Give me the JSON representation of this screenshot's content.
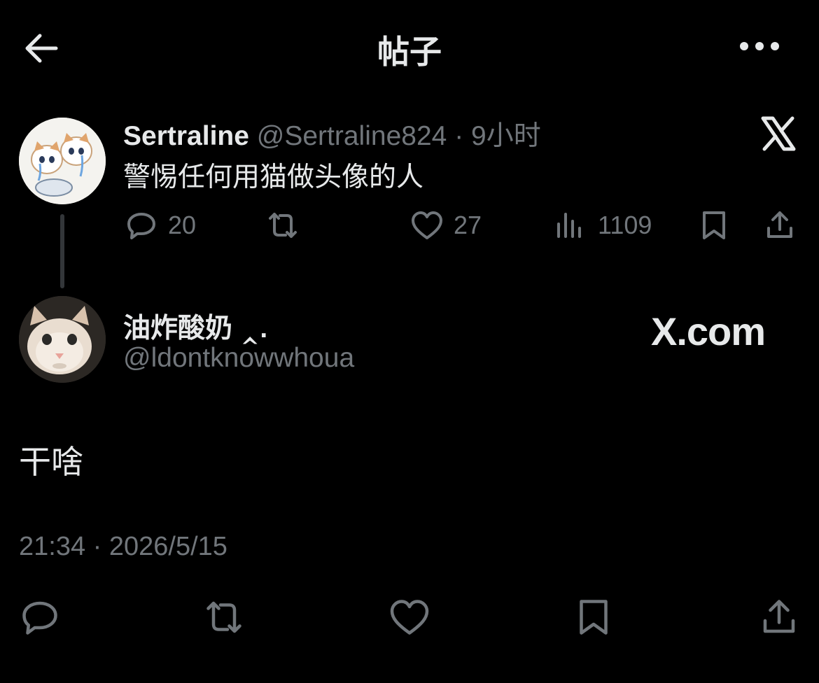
{
  "header": {
    "title": "帖子",
    "back_icon": "back-arrow-icon",
    "more_icon": "more-horizontal-icon"
  },
  "quoted_post": {
    "display_name": "Sertraline",
    "handle": "@Sertraline824",
    "separator": "·",
    "time": "9小时",
    "text": "警惕任何用猫做头像的人",
    "stats": {
      "replies": "20",
      "likes": "27",
      "views": "1109"
    }
  },
  "post": {
    "author_name": "油炸酸奶 ‸.",
    "author_handle": "@ldontknowwhoua",
    "watermark": "X.com",
    "text": "干啥",
    "timestamp": "21:34 · 2026/5/15"
  },
  "colors": {
    "background": "#000000",
    "text": "#e7e9ea",
    "muted": "#71767b"
  }
}
